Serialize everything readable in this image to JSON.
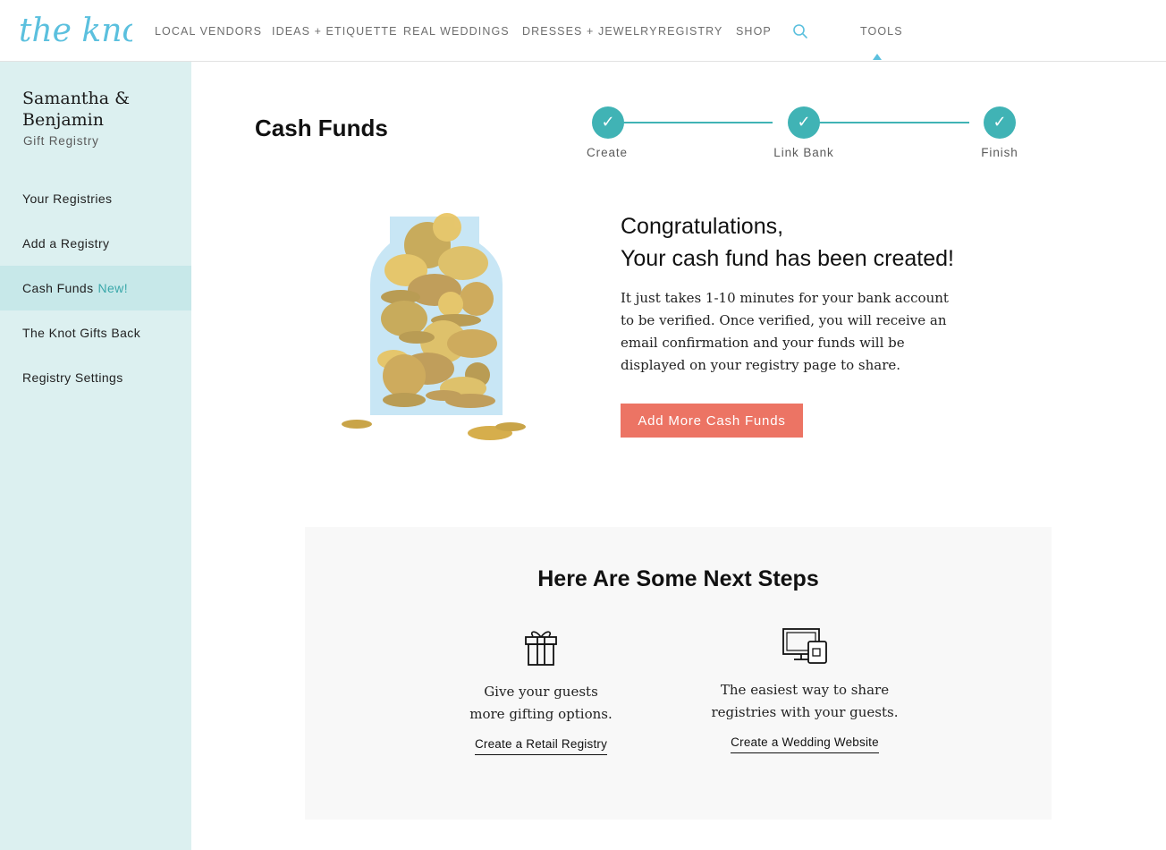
{
  "header": {
    "logo_text": "the knot",
    "nav": [
      {
        "label": "LOCAL  VENDORS"
      },
      {
        "label": "IDEAS + ETIQUETTE"
      },
      {
        "label": "REAL WEDDINGS"
      },
      {
        "label": "DRESSES + JEWELRY"
      },
      {
        "label": "REGISTRY"
      },
      {
        "label": "SHOP"
      }
    ],
    "search_icon": "search-icon",
    "tools_label": "TOOLS",
    "brand_color": "#5bc0de"
  },
  "sidebar": {
    "couple_name": "Samantha & Benjamin",
    "subtitle": "Gift Registry",
    "items": [
      {
        "label": "Your Registries"
      },
      {
        "label": "Add a Registry"
      },
      {
        "label": "Cash Funds",
        "badge": "New!",
        "active": true
      },
      {
        "label": "The Knot Gifts Back"
      },
      {
        "label": "Registry Settings"
      }
    ],
    "background": "#dcf0f0"
  },
  "main": {
    "title": "Cash Funds",
    "stepper": {
      "steps": [
        {
          "label": "Create",
          "done": true
        },
        {
          "label": "Link Bank",
          "done": true
        },
        {
          "label": "Finish",
          "done": true
        }
      ],
      "check_glyph": "✓",
      "color": "#40b3b5"
    },
    "illustration": "coin-jar-illustration",
    "congrats_line1": "Congratulations,",
    "congrats_line2": "Your cash fund has been created!",
    "body": "It just takes 1-10 minutes for your bank account to be verified. Once verified, you will receive an email confirmation and your funds will be displayed on your registry page to share.",
    "cta_label": "Add More Cash Funds",
    "cta_color": "#ec7464"
  },
  "next_steps": {
    "title": "Here Are Some Next Steps",
    "items": [
      {
        "icon": "gift-icon",
        "desc_line1": "Give your guests",
        "desc_line2": "more gifting options.",
        "link": "Create a Retail Registry"
      },
      {
        "icon": "devices-icon",
        "desc_line1": "The easiest way to share",
        "desc_line2": "registries with your guests.",
        "link": "Create a Wedding Website"
      }
    ]
  }
}
